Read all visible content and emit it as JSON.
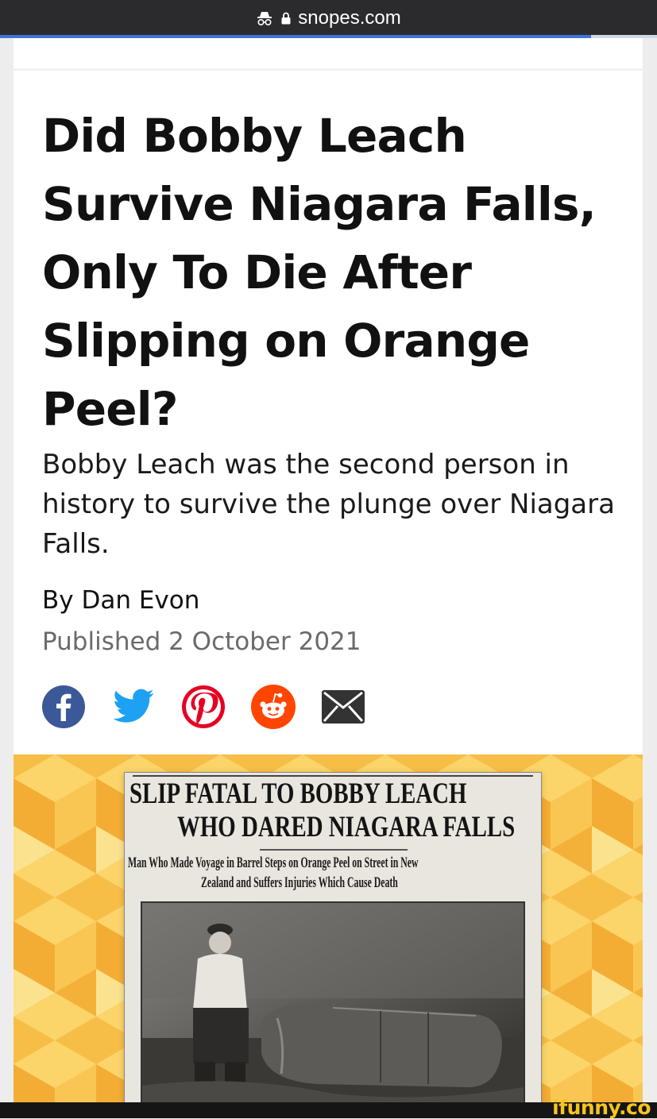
{
  "browser": {
    "url": "snopes.com",
    "incognito_icon": "incognito-icon",
    "lock_icon": "lock-icon",
    "load_progress_percent": 90
  },
  "article": {
    "title": "Did Bobby Leach Survive Niagara Falls, Only To Die After Slipping on Orange Peel?",
    "subtitle": "Bobby Leach was the second person in history to survive the plunge over Niagara Falls.",
    "byline": "By Dan Evon",
    "published": "Published 2 October 2021"
  },
  "share": {
    "icons": [
      "facebook-icon",
      "twitter-icon",
      "pinterest-icon",
      "reddit-icon",
      "email-icon"
    ],
    "colors": {
      "facebook": "#3b5998",
      "twitter": "#1da1f2",
      "pinterest": "#e60023",
      "reddit": "#ff4500",
      "email": "#333333"
    }
  },
  "hero": {
    "background_colors": [
      "#f5b843",
      "#f9cf5a",
      "#fbe28e"
    ],
    "clipping": {
      "headline_line1": "SLIP FATAL TO BOBBY LEACH",
      "headline_line2": "WHO DARED NIAGARA FALLS",
      "deck_line1": "Man Who Made Voyage in Barrel Steps on Orange Peel on Street in New",
      "deck_line2": "Zealand and Suffers Injuries Which Cause Death"
    }
  },
  "watermark": {
    "text": "ifunny.co"
  }
}
